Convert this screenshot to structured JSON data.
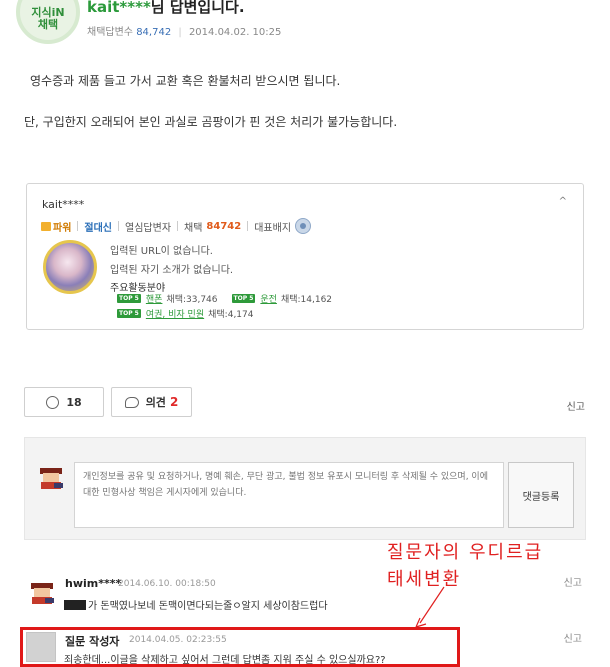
{
  "answer": {
    "badge_line1": "지식iN",
    "badge_line2": "채택",
    "username": "kait****",
    "title_suffix": "님 답변입니다.",
    "stat_label": "채택답변수",
    "stat_value": "84,742",
    "date": "2014.04.02. 10:25",
    "body_line1": "영수증과 제품 들고 가서 교환 혹은 환불처리 받으시면 됩니다.",
    "body_line2": "단, 구입한지 오래되어 본인 과실로 곰팡이가 핀 것은 처리가 불가능합니다."
  },
  "profile": {
    "name": "kait****",
    "toggle_icon": "^",
    "tag_power": "파워",
    "tag_absolute": "절대신",
    "tag_diligent": "열심답변자",
    "tag_choice_label": "채택",
    "tag_choice_value": "84742",
    "tag_badge_label": "대표배지",
    "url_text": "입력된 URL이 없습니다.",
    "intro_text": "입력된 자기 소개가 없습니다.",
    "activity_title": "주요활동분야",
    "activities": [
      {
        "badge": "TOP 5",
        "field": "핸폰",
        "label": "채택:33,746"
      },
      {
        "badge": "TOP 5",
        "field": "운전",
        "label": "채택:14,162"
      },
      {
        "badge": "TOP 5",
        "field": "여권, 비자 민원",
        "label": "채택:4,174"
      }
    ]
  },
  "reactions": {
    "like_count": "18",
    "opinion_label": "의견",
    "opinion_count": "2",
    "report_label": "신고"
  },
  "comment_box": {
    "placeholder": "개인정보를 공유 및 요청하거나, 명예 훼손, 무단 광고, 불법 정보 유포시 모니터링 후 삭제될 수 있으며, 이에 대한 민형사상 책임은 게시자에게 있습니다.",
    "submit_label": "댓글등록"
  },
  "annotation": {
    "line1": "질문자의  우디르급",
    "line2": "태세변환"
  },
  "comments": [
    {
      "author": "hwim****",
      "date": "2014.06.10. 00:18:50",
      "text": "가 돈맥였나보네 돈맥이면다되는줄ㅇ알지 세상이참드럽다",
      "report": "신고"
    },
    {
      "author": "질문 작성자",
      "date": "2014.04.05. 02:23:55",
      "text": "죄송한데...이글을 삭제하고 싶어서 그런데 답변좀 지워 주실 수 있으실까요??",
      "report": "신고"
    }
  ],
  "colors": {
    "accent_green": "#2b9a3b",
    "link_blue": "#3a6fb5",
    "highlight_red": "#e01818"
  }
}
